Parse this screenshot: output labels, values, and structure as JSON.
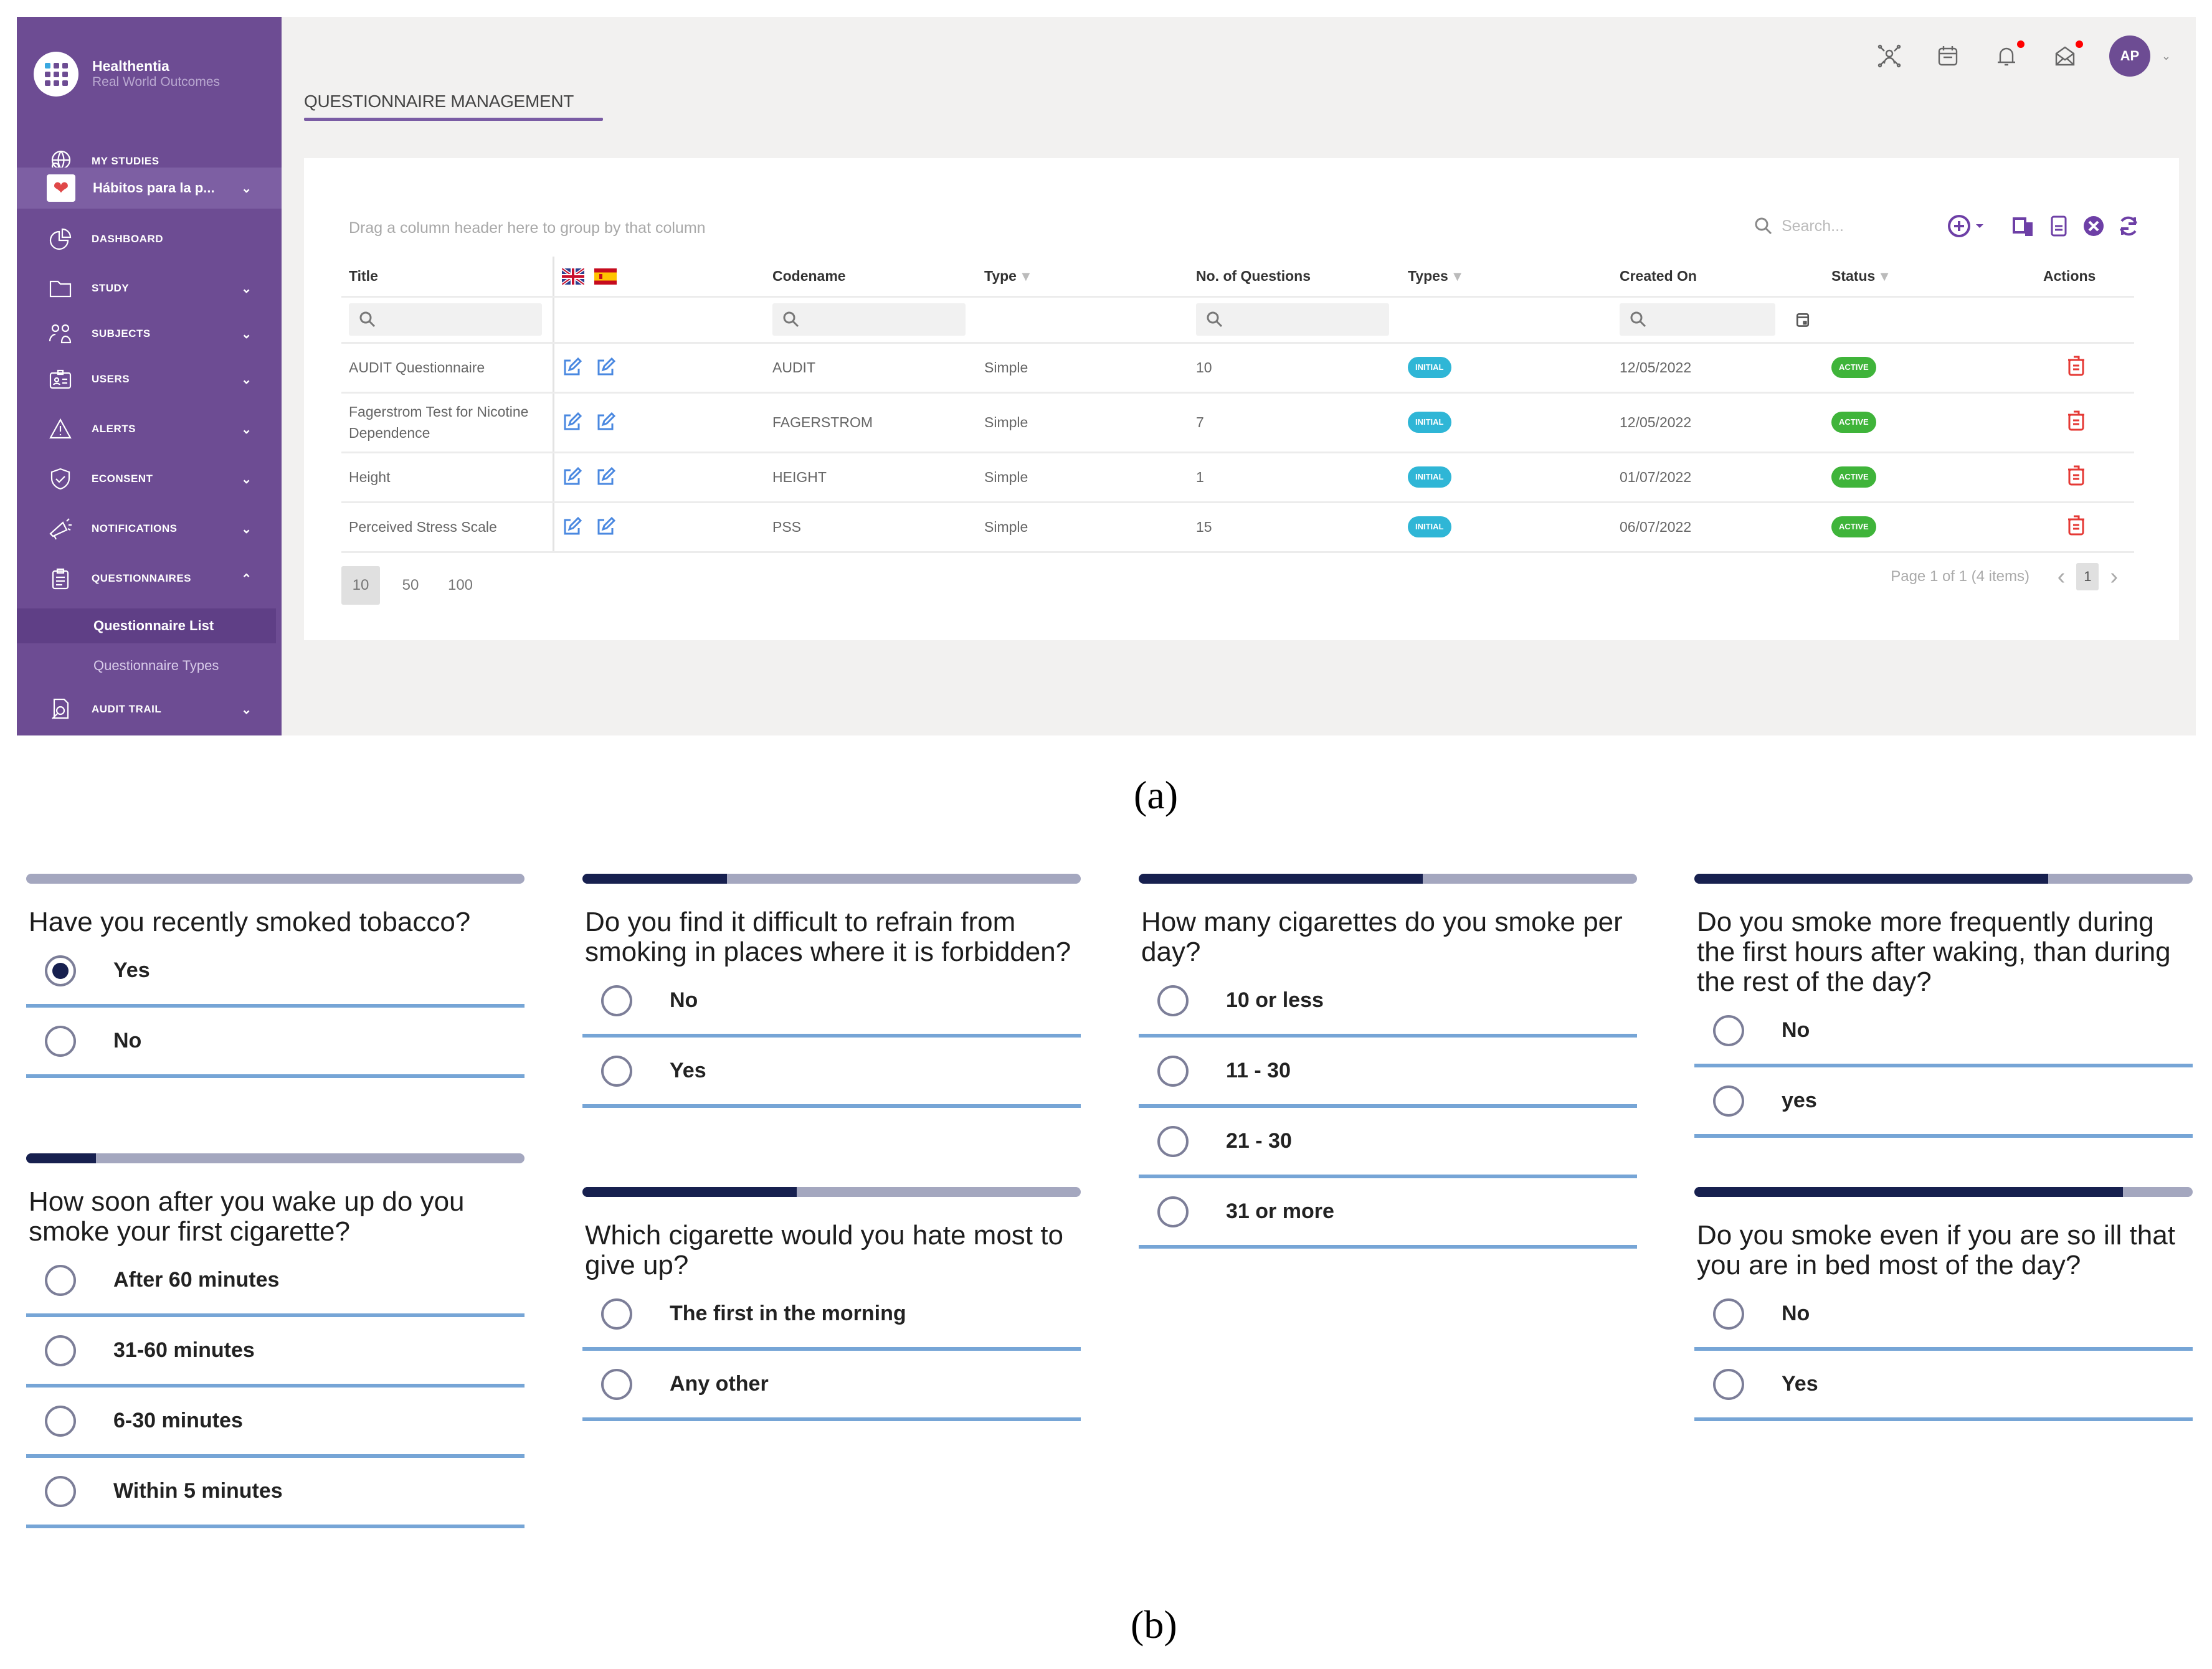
{
  "panel_a": {
    "brand": {
      "name": "Healthentia",
      "subtitle": "Real World Outcomes"
    },
    "sidebar": {
      "items": [
        {
          "label": "MY STUDIES",
          "icon": "globe-search-icon",
          "has_chevron": false
        },
        {
          "label": "Hábitos para la p...",
          "icon": "heart-image-icon",
          "has_chevron": true,
          "chevron": "⌄"
        },
        {
          "label": "DASHBOARD",
          "icon": "pie-chart-icon",
          "has_chevron": false
        },
        {
          "label": "STUDY",
          "icon": "folder-icon",
          "has_chevron": true,
          "chevron": "⌄"
        },
        {
          "label": "SUBJECTS",
          "icon": "subjects-icon",
          "has_chevron": true,
          "chevron": "⌄"
        },
        {
          "label": "USERS",
          "icon": "id-card-icon",
          "has_chevron": true,
          "chevron": "⌄"
        },
        {
          "label": "ALERTS",
          "icon": "warning-icon",
          "has_chevron": true,
          "chevron": "⌄"
        },
        {
          "label": "ECONSENT",
          "icon": "shield-check-icon",
          "has_chevron": true,
          "chevron": "⌄"
        },
        {
          "label": "NOTIFICATIONS",
          "icon": "megaphone-icon",
          "has_chevron": true,
          "chevron": "⌄"
        },
        {
          "label": "QUESTIONNAIRES",
          "icon": "clipboard-icon",
          "has_chevron": true,
          "chevron": "⌃"
        },
        {
          "label": "AUDIT TRAIL",
          "icon": "audit-search-icon",
          "has_chevron": true,
          "chevron": "⌄"
        }
      ],
      "sub_items": [
        {
          "label": "Questionnaire List",
          "active": true
        },
        {
          "label": "Questionnaire Types",
          "active": false
        }
      ]
    },
    "header": {
      "icons": [
        "team-icon",
        "calendar-icon",
        "bell-icon",
        "mail-icon"
      ],
      "avatar_initials": "AP",
      "avatar_chevron": "⌄"
    },
    "page_title": "QUESTIONNAIRE MANAGEMENT",
    "grid": {
      "group_hint": "Drag a column header here to group by that column",
      "search_placeholder": "Search...",
      "columns": [
        "Title",
        "",
        "Codename",
        "Type",
        "No. of Questions",
        "Types",
        "Created On",
        "Status",
        "Actions"
      ],
      "filterable_columns": [
        "Type",
        "Types",
        "Status"
      ],
      "filter_glyph": "▼",
      "rows": [
        {
          "title": "AUDIT Questionnaire",
          "codename": "AUDIT",
          "type": "Simple",
          "questions": "10",
          "types_badge": "INITIAL",
          "created_on": "12/05/2022",
          "status": "ACTIVE"
        },
        {
          "title": "Fagerstrom Test for Nicotine Dependence",
          "codename": "FAGERSTROM",
          "type": "Simple",
          "questions": "7",
          "types_badge": "INITIAL",
          "created_on": "12/05/2022",
          "status": "ACTIVE"
        },
        {
          "title": "Height",
          "codename": "HEIGHT",
          "type": "Simple",
          "questions": "1",
          "types_badge": "INITIAL",
          "created_on": "01/07/2022",
          "status": "ACTIVE"
        },
        {
          "title": "Perceived Stress Scale",
          "codename": "PSS",
          "type": "Simple",
          "questions": "15",
          "types_badge": "INITIAL",
          "created_on": "06/07/2022",
          "status": "ACTIVE"
        }
      ],
      "pager": {
        "sizes": [
          "10",
          "50",
          "100"
        ],
        "selected_size": "10",
        "info": "Page 1 of 1 (4 items)",
        "current_page": "1",
        "prev": "‹",
        "next": "›"
      }
    },
    "colors": {
      "sidebar": "#6d4c93",
      "link": "#4a88e0",
      "initial_badge": "#2fb6d6",
      "active_badge": "#3fb43a",
      "delete": "#e53935"
    }
  },
  "captions": {
    "a": "(a)",
    "b": "(b)"
  },
  "panel_b": {
    "colors": {
      "progress_fill": "#17204f",
      "progress_track": "#a4a7bf",
      "option_divider": "#76a5d6"
    },
    "questions": [
      {
        "text": "Have you recently smoked tobacco?",
        "progress": 0.0,
        "options": [
          "Yes",
          "No"
        ],
        "selected": 0
      },
      {
        "text": "How soon after you wake up do you smoke your first cigarette?",
        "progress": 0.14,
        "options": [
          "After 60 minutes",
          "31-60 minutes",
          "6-30 minutes",
          "Within 5 minutes"
        ],
        "selected": null
      },
      {
        "text": "Do you find it difficult to refrain from smoking in places where it is forbidden?",
        "progress": 0.29,
        "options": [
          "No",
          "Yes"
        ],
        "selected": null
      },
      {
        "text": "Which cigarette would you hate most to give up?",
        "progress": 0.43,
        "options": [
          "The first in the morning",
          "Any other"
        ],
        "selected": null
      },
      {
        "text": "How many cigarettes do you smoke per day?",
        "progress": 0.57,
        "options": [
          "10 or less",
          "11 - 30",
          "21 - 30",
          "31 or more"
        ],
        "selected": null
      },
      {
        "text": "Do you smoke more frequently during the first hours after waking, than during the rest of the day?",
        "progress": 0.71,
        "options": [
          "No",
          "yes"
        ],
        "selected": null
      },
      {
        "text": "Do you smoke even if you are so ill that you are in bed most of the day?",
        "progress": 0.86,
        "options": [
          "No",
          "Yes"
        ],
        "selected": null
      }
    ]
  }
}
